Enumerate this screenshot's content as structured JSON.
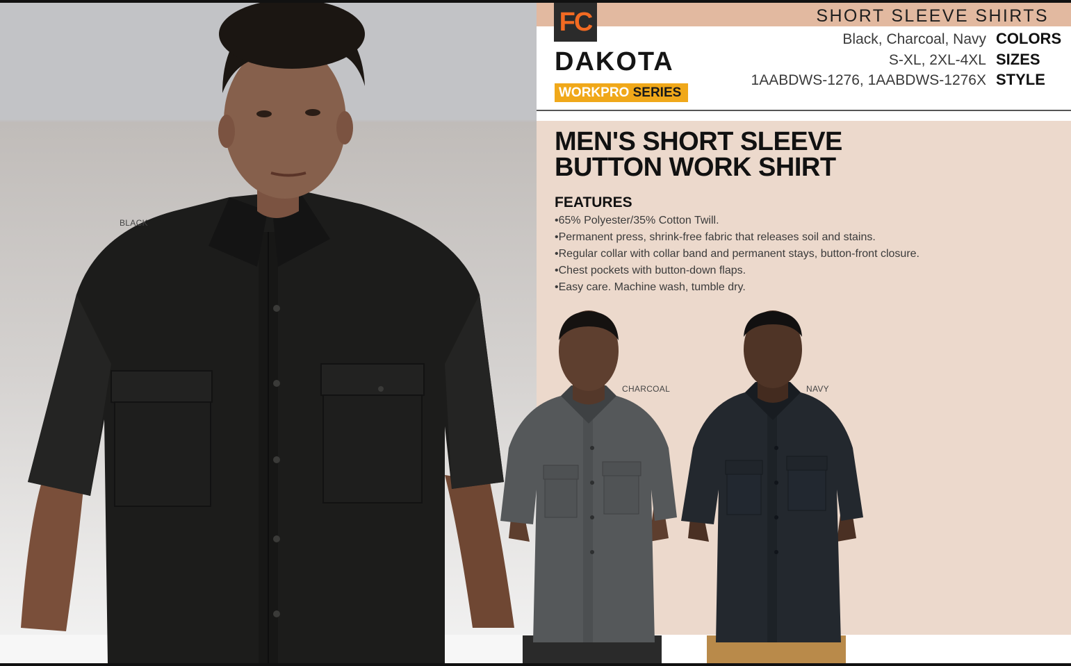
{
  "header": {
    "category": "SHORT SLEEVE SHIRTS"
  },
  "brand": {
    "fc": "FC",
    "name": "DAKOTA",
    "series_a": "WORKPRO",
    "series_b": "SERIES"
  },
  "specs": [
    {
      "key": "COLORS",
      "value": "Black, Charcoal, Navy"
    },
    {
      "key": "SIZES",
      "value": "S-XL, 2XL-4XL"
    },
    {
      "key": "STYLE",
      "value": "1AABDWS-1276, 1AABDWS-1276X"
    }
  ],
  "product": {
    "title_line1": "MEN'S SHORT SLEEVE",
    "title_line2": "BUTTON WORK SHIRT",
    "features_heading": "FEATURES",
    "features": [
      "65% Polyester/35% Cotton Twill.",
      "Permanent press, shrink-free fabric that releases soil and stains.",
      "Regular collar with collar band and permanent stays, button-front closure.",
      "Chest pockets with button-down flaps.",
      "Easy care. Machine wash, tumble dry."
    ]
  },
  "color_labels": {
    "black": "BLACK",
    "charcoal": "CHARCOAL",
    "navy": "NAVY"
  },
  "colors": {
    "accent_band": "#e2b9a0",
    "panel_beige": "#ecd9cc",
    "series_yellow": "#f0a81a",
    "fc_orange": "#f26a22",
    "shirt_black": "#1a1a1a",
    "shirt_charcoal": "#55585a",
    "shirt_navy": "#23282e"
  }
}
